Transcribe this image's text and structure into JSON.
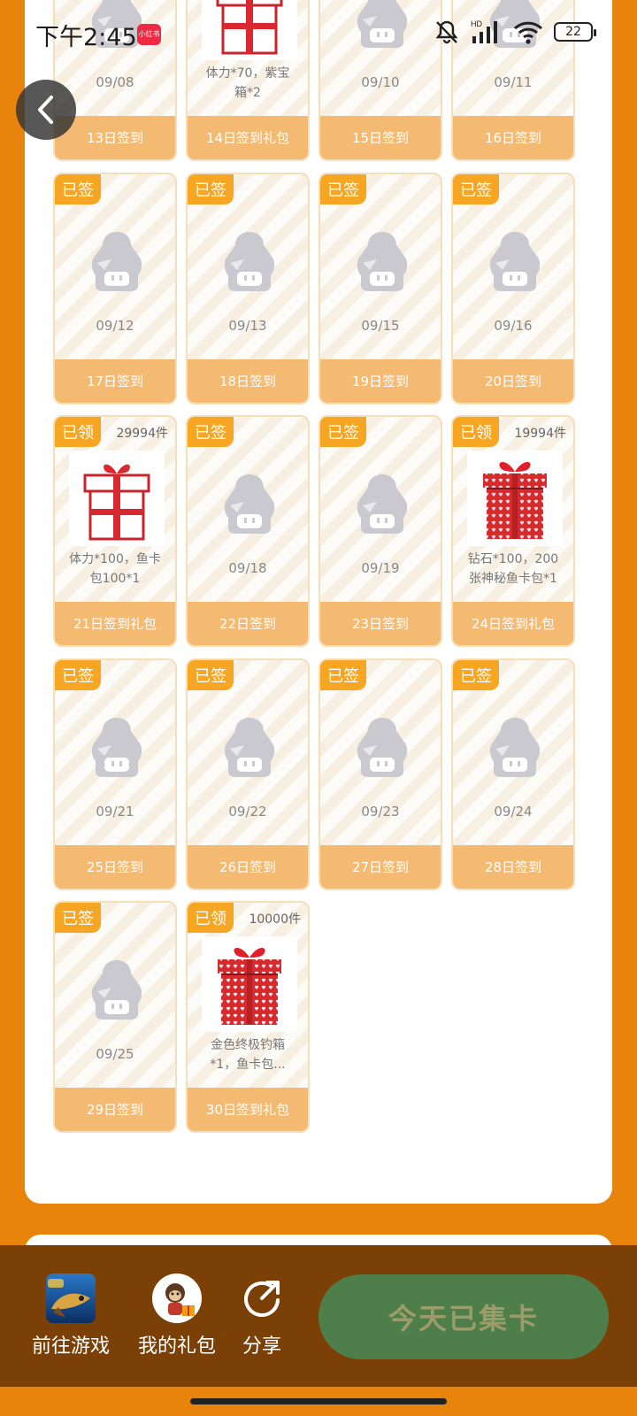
{
  "status_bar": {
    "time": "下午2:45",
    "app_badge": "小红书",
    "battery": "22"
  },
  "cards": [
    {
      "kind": "avatar",
      "badge": "",
      "count": "",
      "text": "09/08",
      "footer": "13日签到"
    },
    {
      "kind": "gift-white",
      "badge": "",
      "count": "",
      "text": "体力*70，紫宝\n箱*2",
      "footer": "14日签到礼包"
    },
    {
      "kind": "avatar",
      "badge": "",
      "count": "",
      "text": "09/10",
      "footer": "15日签到"
    },
    {
      "kind": "avatar",
      "badge": "",
      "count": "",
      "text": "09/11",
      "footer": "16日签到"
    },
    {
      "kind": "avatar",
      "badge": "已签",
      "count": "",
      "text": "09/12",
      "footer": "17日签到"
    },
    {
      "kind": "avatar",
      "badge": "已签",
      "count": "",
      "text": "09/13",
      "footer": "18日签到"
    },
    {
      "kind": "avatar",
      "badge": "已签",
      "count": "",
      "text": "09/15",
      "footer": "19日签到"
    },
    {
      "kind": "avatar",
      "badge": "已签",
      "count": "",
      "text": "09/16",
      "footer": "20日签到"
    },
    {
      "kind": "gift-white",
      "badge": "已领",
      "count": "29994件",
      "text": "体力*100，鱼卡\n包100*1",
      "footer": "21日签到礼包"
    },
    {
      "kind": "avatar",
      "badge": "已签",
      "count": "",
      "text": "09/18",
      "footer": "22日签到"
    },
    {
      "kind": "avatar",
      "badge": "已签",
      "count": "",
      "text": "09/19",
      "footer": "23日签到"
    },
    {
      "kind": "gift-red",
      "badge": "已领",
      "count": "19994件",
      "text": "钻石*100，200\n张神秘鱼卡包*1",
      "footer": "24日签到礼包"
    },
    {
      "kind": "avatar",
      "badge": "已签",
      "count": "",
      "text": "09/21",
      "footer": "25日签到"
    },
    {
      "kind": "avatar",
      "badge": "已签",
      "count": "",
      "text": "09/22",
      "footer": "26日签到"
    },
    {
      "kind": "avatar",
      "badge": "已签",
      "count": "",
      "text": "09/23",
      "footer": "27日签到"
    },
    {
      "kind": "avatar",
      "badge": "已签",
      "count": "",
      "text": "09/24",
      "footer": "28日签到"
    },
    {
      "kind": "avatar",
      "badge": "已签",
      "count": "",
      "text": "09/25",
      "footer": "29日签到"
    },
    {
      "kind": "gift-red",
      "badge": "已领",
      "count": "10000件",
      "text": "金色终极钓箱\n*1，鱼卡包...",
      "footer": "30日签到礼包"
    }
  ],
  "bottom_nav": {
    "game_label": "前往游戏",
    "gift_label": "我的礼包",
    "share_label": "分享",
    "checkin_label": "今天已集卡"
  },
  "colors": {
    "background": "#E8840B",
    "footer": "#F4BA72",
    "badge": "#F6A623",
    "bottom_bar": "#7B4006",
    "checkin_button": "#4E7E4A"
  }
}
